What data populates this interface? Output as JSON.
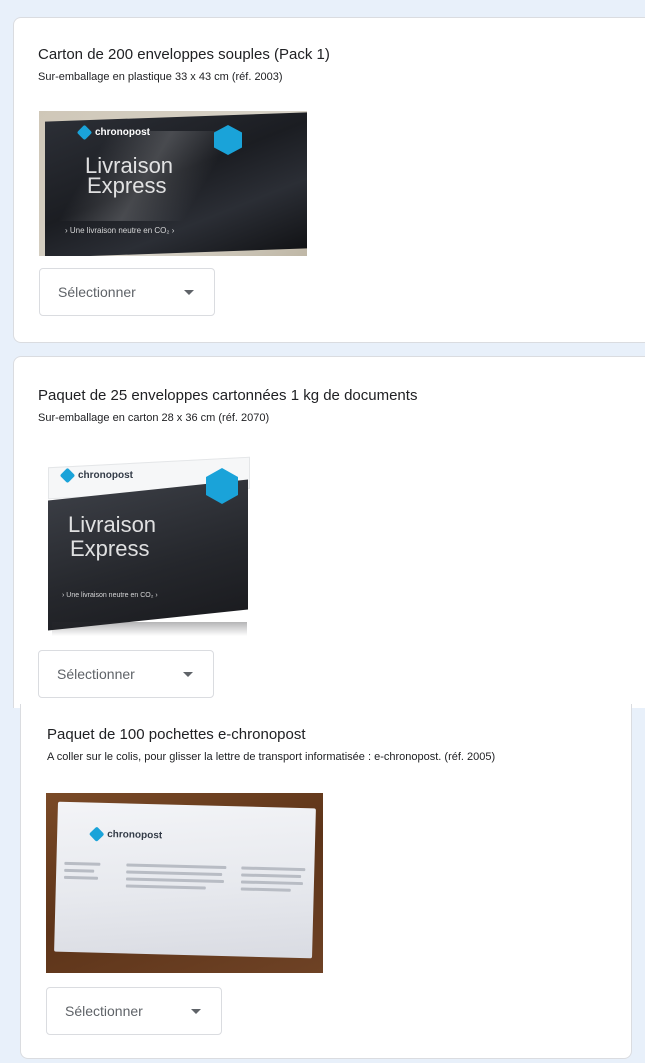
{
  "products": [
    {
      "title": "Carton de 200 enveloppes souples (Pack 1)",
      "subtitle": "Sur-emballage en plastique 33 x 43 cm (réf. 2003)",
      "select_label": "Sélectionner",
      "image": {
        "brand": "chronopost",
        "headline_1": "Livraison",
        "headline_2": "Express",
        "tagline": "› Une livraison neutre en CO₂ ›"
      }
    },
    {
      "title": "Paquet de 25 enveloppes cartonnées 1 kg de documents",
      "subtitle": "Sur-emballage en carton 28 x 36 cm (réf. 2070)",
      "select_label": "Sélectionner",
      "image": {
        "brand": "chronopost",
        "headline_1": "Livraison",
        "headline_2": "Express",
        "tagline": "› Une livraison neutre en CO₂ ›"
      }
    },
    {
      "title": "Paquet de 100 pochettes e-chronopost",
      "subtitle": "A coller sur le colis, pour glisser la lettre de transport informatisée : e-chronopost. (réf. 2005)",
      "select_label": "Sélectionner",
      "image": {
        "brand": "chronopost"
      }
    }
  ],
  "colors": {
    "page_background": "#e8f0fa",
    "card_border": "#dadce0",
    "brand_blue": "#1aa3d9"
  }
}
